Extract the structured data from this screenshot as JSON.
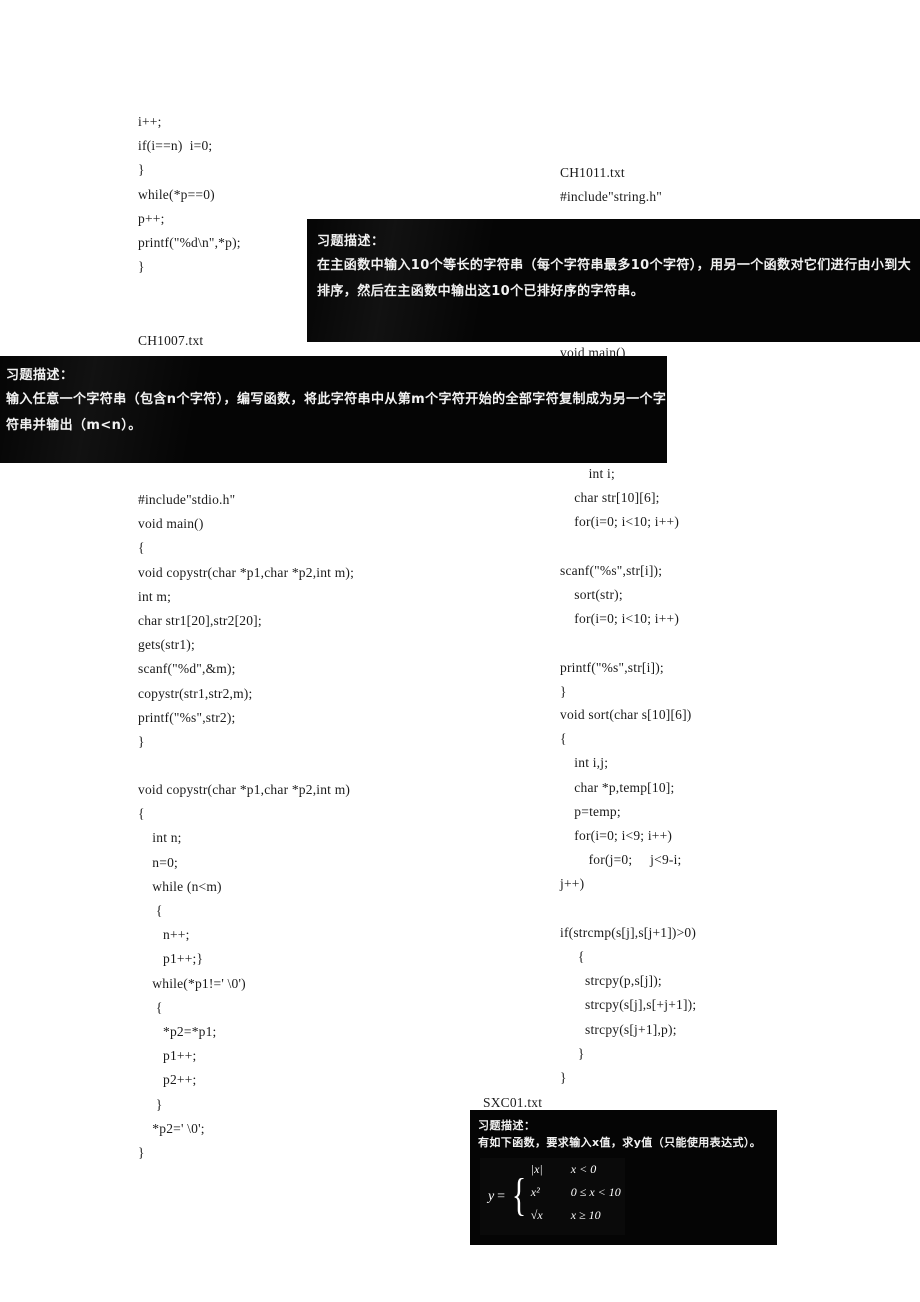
{
  "page": {
    "background": "#ffffff",
    "dark_box_color": "#050505",
    "text_color": "#1a1a1a"
  },
  "left_column": {
    "code_top": "i++;\nif(i==n)  i=0;\n}\nwhile(*p==0)\np++;\nprintf(\"%d\\n\",*p);\n}",
    "file_label_ch1007": "CH1007.txt",
    "code_main": "#include\"stdio.h\"\nvoid main()\n{\nvoid copystr(char *p1,char *p2,int m);\nint m;\nchar str1[20],str2[20];\ngets(str1);\nscanf(\"%d\",&m);\ncopystr(str1,str2,m);\nprintf(\"%s\",str2);\n}",
    "code_copystr": "void copystr(char *p1,char *p2,int m)\n{\n    int n;\n    n=0;\n    while (n<m)\n     {\n       n++;\n       p1++;}\n    while(*p1!=' \\0')\n     {\n       *p2=*p1;\n       p1++;\n       p2++;\n     }\n    *p2=' \\0';\n}"
  },
  "right_column": {
    "file_label_ch1011": "CH1011.txt",
    "include_line": "#include\"string.h\"",
    "code_main": "void main()\n{\n    void\nsort(char\ns[10][6]);\n        int i;\n    char str[10][6];\n    for(i=0; i<10; i++)\n\nscanf(\"%s\",str[i]);\n    sort(str);\n    for(i=0; i<10; i++)\n\nprintf(\"%s\",str[i]);\n}",
    "code_sort": "void sort(char s[10][6])\n{\n    int i,j;\n    char *p,temp[10];\n    p=temp;\n    for(i=0; i<9; i++)\n        for(j=0;     j<9-i;\nj++)\n\nif(strcmp(s[j],s[j+1])>0)\n     {\n       strcpy(p,s[j]);\n       strcpy(s[j],s[+j+1]);\n       strcpy(s[j+1],p);\n     }\n}",
    "file_label_sxc01": "SXC01.txt"
  },
  "description_boxes": {
    "ch1011": {
      "title": "习题描述：",
      "body": "在主函数中输入10个等长的字符串（每个字符串最多10个字符），用另一个函数对它们进行由小到大排序，然后在主函数中输出这10个已排好序的字符串。"
    },
    "ch1007": {
      "title": "习题描述：",
      "body": "输入任意一个字符串（包含n个字符），编写函数，将此字符串中从第m个字符开始的全部字符复制成为另一个字符串并输出（m<n）。"
    },
    "sxc01": {
      "title": "习题描述：",
      "body": "有如下函数，要求输入x值，求y值（只能使用表达式）。",
      "formula": {
        "lhs": "y",
        "equals": "=",
        "rows": [
          {
            "expr": "|x|",
            "condition": "x < 0"
          },
          {
            "expr": "x²",
            "condition": "0 ≤ x < 10"
          },
          {
            "expr": "√x",
            "condition": "x ≥ 10"
          }
        ]
      }
    }
  }
}
